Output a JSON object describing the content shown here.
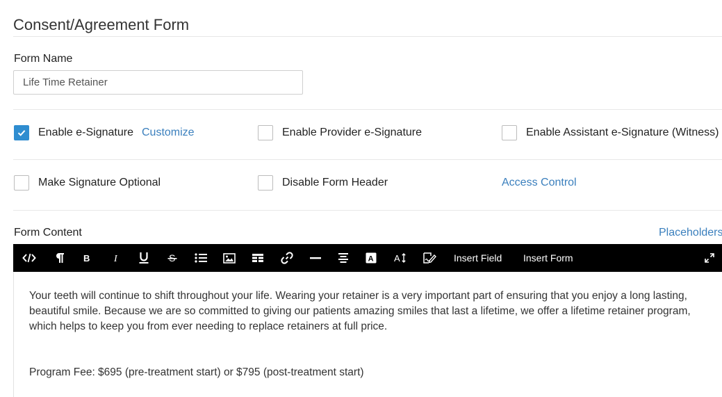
{
  "page": {
    "title": "Consent/Agreement Form"
  },
  "form_name": {
    "label": "Form Name",
    "value": "Life Time Retainer"
  },
  "options": {
    "enable_esignature": {
      "label": "Enable e-Signature",
      "checked": true
    },
    "customize_link": "Customize",
    "enable_provider_esignature": {
      "label": "Enable Provider e-Signature",
      "checked": false
    },
    "enable_assistant_esignature": {
      "label": "Enable Assistant e-Signature (Witness)",
      "checked": false
    },
    "make_signature_optional": {
      "label": "Make Signature Optional",
      "checked": false
    },
    "disable_form_header": {
      "label": "Disable Form Header",
      "checked": false
    },
    "access_control_link": "Access Control"
  },
  "form_content": {
    "label": "Form Content",
    "placeholders_link": "Placeholders",
    "toolbar": {
      "icons": [
        "code-view-icon",
        "paragraph-icon",
        "bold-icon",
        "italic-icon",
        "underline-icon",
        "strikethrough-icon",
        "bullet-list-icon",
        "image-icon",
        "table-icon",
        "link-icon",
        "horizontal-rule-icon",
        "align-center-icon",
        "text-color-icon",
        "font-size-icon",
        "signature-icon",
        "fullscreen-icon"
      ],
      "insert_field": "Insert Field",
      "insert_form": "Insert Form"
    },
    "body": {
      "paragraph1": "Your teeth will continue to shift throughout your life. Wearing your retainer is a very important part of ensuring that you enjoy a long lasting, beautiful smile. Because we are so committed to giving our patients amazing smiles that last a lifetime, we offer a lifetime retainer program, which helps to keep you from ever needing to replace retainers at full price.",
      "paragraph2": "Program Fee: $695 (pre-treatment start) or $795 (post-treatment start)"
    }
  },
  "colors": {
    "accent": "#2f8dd0",
    "link": "#3a7fbd",
    "toolbar_bg": "#000000"
  }
}
